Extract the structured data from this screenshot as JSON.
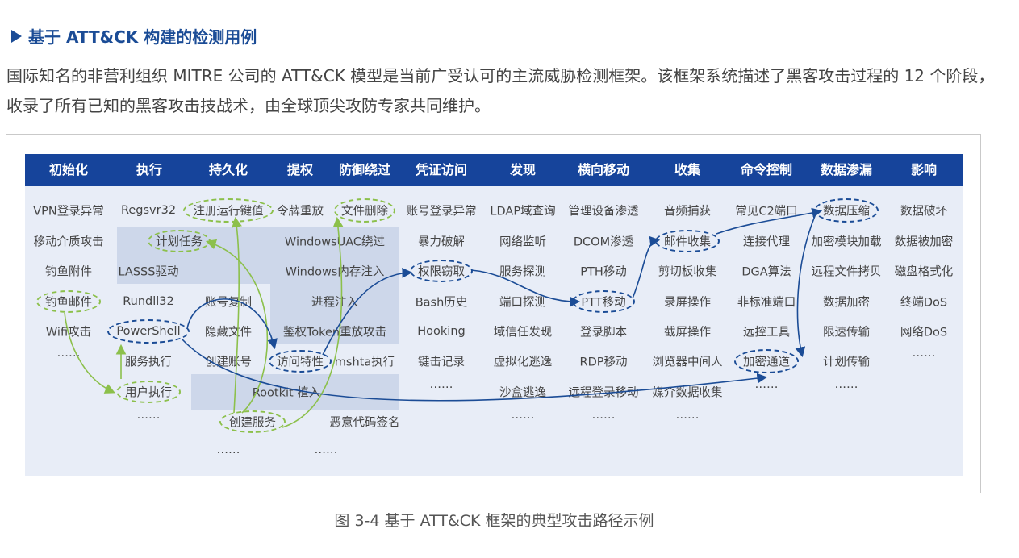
{
  "heading": "基于 ATT&CK 构建的检测用例",
  "paragraph": "国际知名的非营利组织 MITRE 公司的 ATT&CK 模型是当前广受认可的主流威胁检测框架。该框架系统描述了黑客攻击过程的 12 个阶段，收录了所有已知的黑客攻击技战术，由全球顶尖攻防专家共同维护。",
  "caption": "图 3-4 基于 ATT&CK 框架的典型攻击路径示例",
  "columns": [
    "初始化",
    "执行",
    "持久化",
    "提权",
    "防御绕过",
    "凭证访问",
    "发现",
    "横向移动",
    "收集",
    "命令控制",
    "数据渗漏",
    "影响"
  ],
  "cells": {
    "c0": [
      "VPN登录异常",
      "移动介质攻击",
      "钓鱼附件",
      "钓鱼邮件",
      "Wifi攻击",
      "……"
    ],
    "c1": [
      "Regsvr32",
      "LASSS驱动",
      "Rundll32",
      "PowerShell",
      "服务执行",
      "用户执行",
      "……"
    ],
    "c2": [
      "注册运行键值",
      "计划任务",
      "账号复制",
      "隐藏文件",
      "创建账号",
      "创建服务",
      "……"
    ],
    "c3": [
      "令牌重放",
      "访问特性"
    ],
    "c4": [
      "文件删除",
      "WindowsUAC绕过",
      "Windows内存注入",
      "进程注入",
      "鉴权Token重放攻击",
      "mshta执行",
      "恶意代码签名",
      "……"
    ],
    "c3wide": [
      "Rootkit 植入"
    ],
    "c5": [
      "账号登录异常",
      "暴力破解",
      "权限窃取",
      "Bash历史",
      "Hooking",
      "键击记录",
      "……"
    ],
    "c6": [
      "LDAP域查询",
      "网络监听",
      "服务探测",
      "端口探测",
      "域信任发现",
      "虚拟化逃逸",
      "沙盒逃逸",
      "……"
    ],
    "c7": [
      "管理设备渗透",
      "DCOM渗透",
      "PTH移动",
      "PTT移动",
      "登录脚本",
      "RDP移动",
      "远程登录移动",
      "……"
    ],
    "c8": [
      "音频捕获",
      "邮件收集",
      "剪切板收集",
      "录屏操作",
      "截屏操作",
      "浏览器中间人",
      "媒介数据收集",
      "……"
    ],
    "c9": [
      "常见C2端口",
      "连接代理",
      "DGA算法",
      "非标准端口",
      "远控工具",
      "加密通道",
      "……"
    ],
    "c10": [
      "数据压缩",
      "加密模块加载",
      "远程文件拷贝",
      "数据加密",
      "限速传输",
      "计划传输",
      "……"
    ],
    "c11": [
      "数据破坏",
      "数据被加密",
      "磁盘格式化",
      "终端DoS",
      "网络DoS",
      "……"
    ]
  },
  "colors": {
    "header": "#16449b",
    "green_path": "#8cc04b",
    "blue_path": "#1b4c96",
    "panel": "#e8edf7",
    "shade": "#cdd7ea"
  }
}
